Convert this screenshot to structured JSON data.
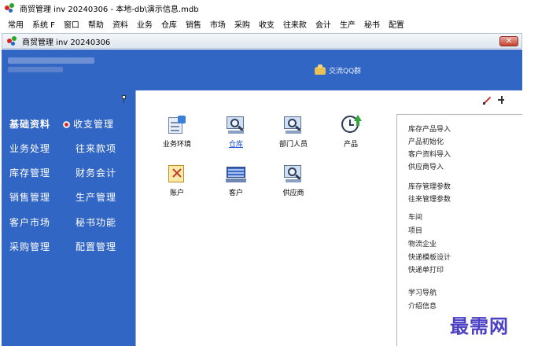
{
  "window": {
    "title": "商贸管理 inv 20240306 - 本地-db\\演示信息.mdb"
  },
  "menu": [
    "常用",
    "系统 F",
    "窗口",
    "帮助",
    "资料",
    "业务",
    "仓库",
    "销售",
    "市场",
    "采购",
    "收支",
    "往来款",
    "会计",
    "生产",
    "秘书",
    "配置"
  ],
  "child_window": {
    "title": "商贸管理 inv 20240306",
    "close_label": "✕"
  },
  "banner": {
    "qq_group_label": "交流QQ群"
  },
  "sidebar": {
    "items": [
      {
        "label": "基础资料"
      },
      {
        "label": "收支管理"
      },
      {
        "label": "业务处理"
      },
      {
        "label": "往来款项"
      },
      {
        "label": "库存管理"
      },
      {
        "label": "财务会计"
      },
      {
        "label": "销售管理"
      },
      {
        "label": "生产管理"
      },
      {
        "label": "客户市场"
      },
      {
        "label": "秘书功能"
      },
      {
        "label": "采购管理"
      },
      {
        "label": "配置管理"
      }
    ]
  },
  "tiles": [
    {
      "label": "业务环境"
    },
    {
      "label": "仓库"
    },
    {
      "label": "部门人员"
    },
    {
      "label": "产品"
    },
    {
      "label": "账户"
    },
    {
      "label": "客户"
    },
    {
      "label": "供应商"
    }
  ],
  "right_panel": {
    "links": [
      "库存产品导入",
      "产品初始化",
      "客户资料导入",
      "供应商导入",
      "库存管理参数",
      "往来管理参数",
      "车间",
      "项目",
      "物流企业",
      "快递模板设计",
      "快递单打印",
      "学习导航",
      "介绍信息"
    ]
  },
  "watermark": "最需网",
  "colors": {
    "sidebar_bg": "#3266c4",
    "link": "#1b4fd6",
    "watermark": "#4b3fc4"
  }
}
